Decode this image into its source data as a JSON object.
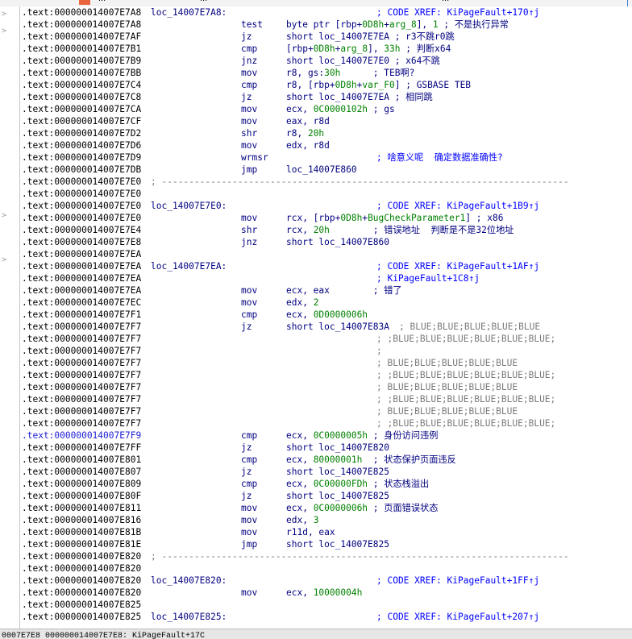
{
  "top_strip": {
    "left_tab": "...",
    "mid_tab": "...",
    "right_tab": "..."
  },
  "status_bar": {
    "text": "0007E7E8 000000014007E7E8: KiPageFault+17C"
  },
  "lines": [
    {
      "addr": ".text:000000014007E7A8",
      "label": "loc_14007E7A8:",
      "cm": "; CODE XREF: KiPageFault+170↑j",
      "cmx": 440
    },
    {
      "addr": ".text:000000014007E7A8",
      "mn": "test",
      "op": "byte ptr [rbp+0D8h+arg_8], 1 ; 不是执行异常"
    },
    {
      "addr": ".text:000000014007E7AF",
      "mn": "jz",
      "op": "short loc_14007E7EA ; r3不跳r0跳"
    },
    {
      "addr": ".text:000000014007E7B1",
      "mn": "cmp",
      "op": "[rbp+0D8h+arg_8], 33h ; 判断x64"
    },
    {
      "addr": ".text:000000014007E7B9",
      "mn": "jnz",
      "op": "short loc_14007E7E0 ; x64不跳"
    },
    {
      "addr": ".text:000000014007E7BB",
      "mn": "mov",
      "op": "r8, gs:30h      ; TEB啊?"
    },
    {
      "addr": ".text:000000014007E7C4",
      "mn": "cmp",
      "op": "r8, [rbp+0D8h+var_F0] ; GSBASE TEB"
    },
    {
      "addr": ".text:000000014007E7C8",
      "mn": "jz",
      "op": "short loc_14007E7EA ; 相同跳"
    },
    {
      "addr": ".text:000000014007E7CA",
      "mn": "mov",
      "op": "ecx, 0C0000102h ; gs"
    },
    {
      "addr": ".text:000000014007E7CF",
      "mn": "mov",
      "op": "eax, r8d"
    },
    {
      "addr": ".text:000000014007E7D2",
      "mn": "shr",
      "op": "r8, 20h"
    },
    {
      "addr": ".text:000000014007E7D6",
      "mn": "mov",
      "op": "edx, r8d"
    },
    {
      "addr": ".text:000000014007E7D9",
      "mn": "wrmsr",
      "cm": "; 啥意义呢  确定数据准确性?",
      "cmx": 440
    },
    {
      "addr": ".text:000000014007E7DB",
      "mn": "jmp",
      "op": "loc_14007E860"
    },
    {
      "addr": ".text:000000014007E7E0",
      "sep": "; ---------------------------------------------------------------------------"
    },
    {
      "addr": ".text:000000014007E7E0"
    },
    {
      "addr": ".text:000000014007E7E0",
      "label": "loc_14007E7E0:",
      "cm": "; CODE XREF: KiPageFault+1B9↑j",
      "cmx": 440
    },
    {
      "addr": ".text:000000014007E7E0",
      "mn": "mov",
      "op": "rcx, [rbp+0D8h+BugCheckParameter1] ; x86"
    },
    {
      "addr": ".text:000000014007E7E4",
      "mn": "shr",
      "op": "rcx, 20h        ; 错误地址  判断是不是32位地址"
    },
    {
      "addr": ".text:000000014007E7E8",
      "mn": "jnz",
      "op": "short loc_14007E860"
    },
    {
      "addr": ".text:000000014007E7EA"
    },
    {
      "addr": ".text:000000014007E7EA",
      "label": "loc_14007E7EA:",
      "cm": "; CODE XREF: KiPageFault+1AF↑j",
      "cmx": 440
    },
    {
      "addr": ".text:000000014007E7EA",
      "cm": "; KiPageFault+1C8↑j",
      "cmx": 440
    },
    {
      "addr": ".text:000000014007E7EA",
      "mn": "mov",
      "op": "ecx, eax        ; 错了"
    },
    {
      "addr": ".text:000000014007E7EC",
      "mn": "mov",
      "op": "edx, 2"
    },
    {
      "addr": ".text:000000014007E7F1",
      "mn": "cmp",
      "op": "ecx, 0D0000006h"
    },
    {
      "addr": ".text:000000014007E7F7",
      "mn": "jz",
      "op": "short loc_14007E83A",
      "cm": "; BLUE;BLUE;BLUE;BLUE;BLUE",
      "cmx": 468,
      "blue": true
    },
    {
      "addr": ".text:000000014007E7F7",
      "cm": "; ;BLUE;BLUE;BLUE;BLUE;BLUE;BLUE;",
      "cmx": 440,
      "blue": true
    },
    {
      "addr": ".text:000000014007E7F7",
      "cm": ";",
      "cmx": 440,
      "blue": true
    },
    {
      "addr": ".text:000000014007E7F7",
      "cm": "; BLUE;BLUE;BLUE;BLUE;BLUE",
      "cmx": 440,
      "blue": true
    },
    {
      "addr": ".text:000000014007E7F7",
      "cm": "; ;BLUE;BLUE;BLUE;BLUE;BLUE;BLUE;",
      "cmx": 440,
      "blue": true
    },
    {
      "addr": ".text:000000014007E7F7",
      "cm": "; BLUE;BLUE;BLUE;BLUE;BLUE",
      "cmx": 440,
      "blue": true
    },
    {
      "addr": ".text:000000014007E7F7",
      "cm": "; ;BLUE;BLUE;BLUE;BLUE;BLUE;BLUE;",
      "cmx": 440,
      "blue": true
    },
    {
      "addr": ".text:000000014007E7F7",
      "cm": "; BLUE;BLUE;BLUE;BLUE;BLUE",
      "cmx": 440,
      "blue": true
    },
    {
      "addr": ".text:000000014007E7F7",
      "cm": "; ;BLUE;BLUE;BLUE;BLUE;BLUE;BLUE;",
      "cmx": 440,
      "blue": true
    },
    {
      "addr": ".text:000000014007E7F9",
      "mn": "cmp",
      "op": "ecx, 0C0000005h ; 身份访问违例",
      "hl": true
    },
    {
      "addr": ".text:000000014007E7FF",
      "mn": "jz",
      "op": "short loc_14007E820"
    },
    {
      "addr": ".text:000000014007E801",
      "mn": "cmp",
      "op": "ecx, 80000001h  ; 状态保护页面违反"
    },
    {
      "addr": ".text:000000014007E807",
      "mn": "jz",
      "op": "short loc_14007E825"
    },
    {
      "addr": ".text:000000014007E809",
      "mn": "cmp",
      "op": "ecx, 0C00000FDh ; 状态栈溢出"
    },
    {
      "addr": ".text:000000014007E80F",
      "mn": "jz",
      "op": "short loc_14007E825"
    },
    {
      "addr": ".text:000000014007E811",
      "mn": "mov",
      "op": "ecx, 0C0000006h ; 页面错误状态"
    },
    {
      "addr": ".text:000000014007E816",
      "mn": "mov",
      "op": "edx, 3"
    },
    {
      "addr": ".text:000000014007E81B",
      "mn": "mov",
      "op": "r11d, eax"
    },
    {
      "addr": ".text:000000014007E81E",
      "mn": "jmp",
      "op": "short loc_14007E825"
    },
    {
      "addr": ".text:000000014007E820",
      "sep": "; ---------------------------------------------------------------------------"
    },
    {
      "addr": ".text:000000014007E820"
    },
    {
      "addr": ".text:000000014007E820",
      "label": "loc_14007E820:",
      "cm": "; CODE XREF: KiPageFault+1FF↑j",
      "cmx": 440
    },
    {
      "addr": ".text:000000014007E820",
      "mn": "mov",
      "op": "ecx, 10000004h"
    },
    {
      "addr": ".text:000000014007E825"
    },
    {
      "addr": ".text:000000014007E825",
      "label": "loc_14007E825:",
      "cm": "; CODE XREF: KiPageFault+207↑j",
      "cmx": 440
    }
  ]
}
